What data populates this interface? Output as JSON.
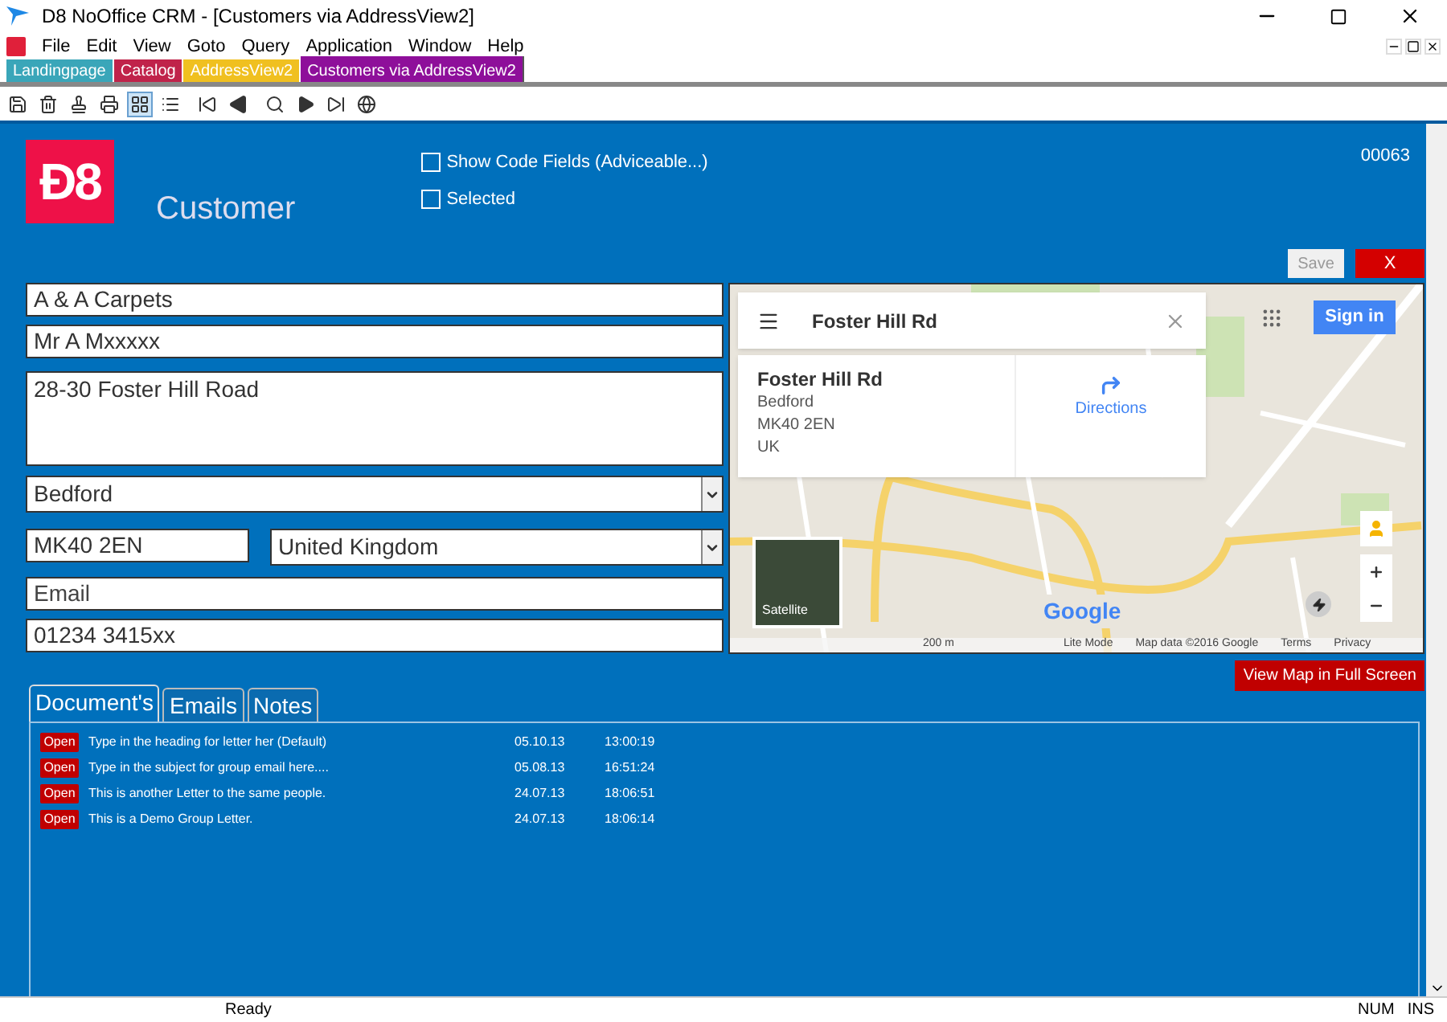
{
  "window": {
    "title": "D8 NoOffice CRM - [Customers via AddressView2]"
  },
  "menu": [
    "File",
    "Edit",
    "View",
    "Goto",
    "Query",
    "Application",
    "Window",
    "Help"
  ],
  "view_tabs": [
    {
      "label": "Landingpage",
      "color": "#3aa6b9",
      "selected": false
    },
    {
      "label": "Catalog",
      "color": "#c0234a",
      "selected": false
    },
    {
      "label": "AddressView2",
      "color": "#f0c020",
      "selected": false
    },
    {
      "label": "Customers via AddressView2",
      "color": "#8e0f9a",
      "selected": true
    }
  ],
  "toolbar": [
    {
      "selected": false
    },
    {
      "selected": false
    },
    {
      "selected": false
    },
    {
      "selected": false
    },
    {
      "selected": true
    },
    {
      "selected": false
    },
    {
      "selected": false
    },
    {
      "selected": false
    },
    {
      "selected": false
    },
    {
      "selected": false
    },
    {
      "selected": false
    },
    {
      "selected": false
    }
  ],
  "header": {
    "logo": "Ð8",
    "title": "Customer",
    "record_number": "00063"
  },
  "options": [
    {
      "label": "Show Code Fields (Adviceable...)",
      "checked": false
    },
    {
      "label": "Selected",
      "checked": false
    }
  ],
  "buttons": {
    "save": "Save",
    "close": "X",
    "full_map": "View Map in Full Screen"
  },
  "fields": {
    "company": "A & A Carpets",
    "contact": "Mr A Mxxxxx",
    "address": "28-30 Foster Hill Road",
    "city": "Bedford",
    "postcode": "MK40 2EN",
    "country": "United Kingdom",
    "email_placeholder": "Email",
    "phone": "01234 3415xx"
  },
  "map": {
    "search": "Foster Hill Rd",
    "place_title": "Foster Hill Rd",
    "place_lines": [
      "Bedford",
      "MK40 2EN",
      "UK"
    ],
    "directions": "Directions",
    "sign_in": "Sign in",
    "satellite": "Satellite",
    "logo": "Google",
    "scale": "200 m",
    "footer": [
      "Lite Mode",
      "Map data ©2016 Google",
      "Terms",
      "Privacy"
    ]
  },
  "doc_tabs": [
    {
      "label": "Document's",
      "selected": true
    },
    {
      "label": "Emails",
      "selected": false
    },
    {
      "label": "Notes",
      "selected": false
    }
  ],
  "documents": [
    {
      "action": "Open",
      "title": "Type in the heading for letter her (Default)",
      "date": "05.10.13",
      "time": "13:00:19"
    },
    {
      "action": "Open",
      "title": "Type in the subject for group email here....",
      "date": "05.08.13",
      "time": "16:51:24"
    },
    {
      "action": "Open",
      "title": "This is another Letter to the same people.",
      "date": "24.07.13",
      "time": "18:06:51"
    },
    {
      "action": "Open",
      "title": "This is a Demo Group Letter.",
      "date": "24.07.13",
      "time": "18:06:14"
    }
  ],
  "status_bar": {
    "message": "Ready",
    "indicators": [
      "NUM",
      "INS"
    ]
  }
}
